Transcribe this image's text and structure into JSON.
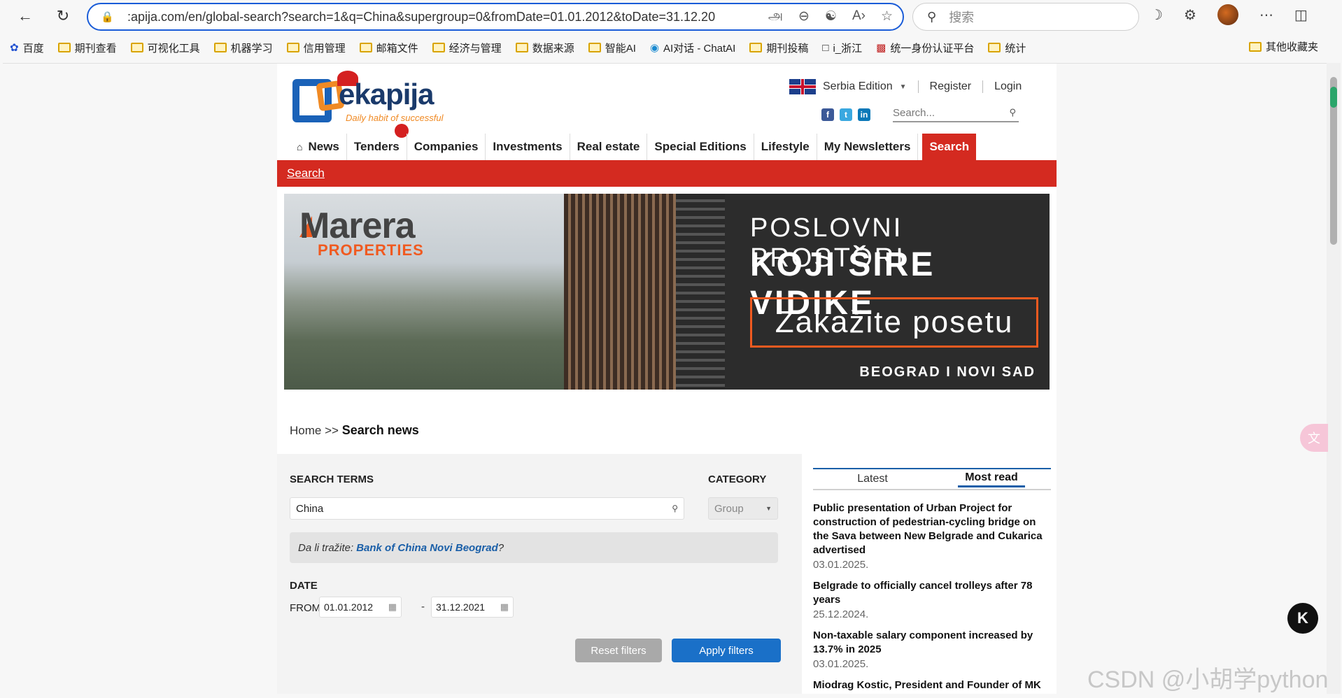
{
  "browser": {
    "url": ":apija.com/en/global-search?search=1&q=China&supergroup=0&fromDate=01.01.2012&toDate=31.12.2021",
    "search_placeholder": "搜索",
    "bookmarks": [
      "百度",
      "期刊查看",
      "可视化工具",
      "机器学习",
      "信用管理",
      "邮箱文件",
      "经济与管理",
      "数据来源",
      "智能AI",
      "AI对话 - ChatAI",
      "期刊投稿",
      "i_浙江",
      "统一身份认证平台",
      "统计"
    ],
    "bookmarks_other": "其他收藏夹"
  },
  "header": {
    "logo_text": "ekapija",
    "logo_tagline": "Daily habit of successful",
    "edition": "Serbia Edition",
    "register": "Register",
    "login": "Login",
    "search_placeholder": "Search..."
  },
  "nav": {
    "items": [
      "News",
      "Tenders",
      "Companies",
      "Investments",
      "Real estate",
      "Special Editions",
      "Lifestyle",
      "My Newsletters",
      "Search"
    ],
    "subbar": "Search"
  },
  "banner": {
    "brand": "Marera",
    "brand_sub": "PROPERTIES",
    "line1": "POSLOVNI PROSTORI",
    "line2": "KOJI ŠIRE VIDIKE",
    "cta": "Zakažite posetu",
    "line3": "BEOGRAD I NOVI SAD"
  },
  "breadcrumb": {
    "home": "Home",
    "sep": ">>",
    "current": "Search news"
  },
  "search": {
    "terms_label": "SEARCH TERMS",
    "terms_value": "China",
    "category_label": "CATEGORY",
    "category_value": "Group",
    "suggest_prefix": "Da li tražite:",
    "suggest_link": "Bank of China Novi Beograd",
    "suggest_suffix": "?",
    "date_label": "DATE",
    "from_label": "FROM",
    "from_date": "01.01.2012",
    "dash": "-",
    "to_date": "31.12.2021",
    "reset_button": "Reset filters",
    "apply_button": "Apply filters"
  },
  "sidebar": {
    "tabs": [
      "Latest",
      "Most read"
    ],
    "active_tab": "Most read",
    "news": [
      {
        "title": "Public presentation of Urban Project for construction of pedestrian-cycling bridge on the Sava between New Belgrade and Cukarica advertised",
        "date": "03.01.2025."
      },
      {
        "title": "Belgrade to officially cancel trolleys after 78 years",
        "date": "25.12.2024."
      },
      {
        "title": "Non-taxable salary component increased by 13.7% in 2025",
        "date": "03.01.2025."
      },
      {
        "title": "Miodrag Kostic, President and Founder of MK",
        "date": ""
      }
    ]
  },
  "watermark": "CSDN @小胡学python",
  "colors": {
    "accent_red": "#d42a20",
    "link_blue": "#1a5fa8",
    "apply_blue": "#1a70c8",
    "reset_grey": "#a9a9a9"
  }
}
